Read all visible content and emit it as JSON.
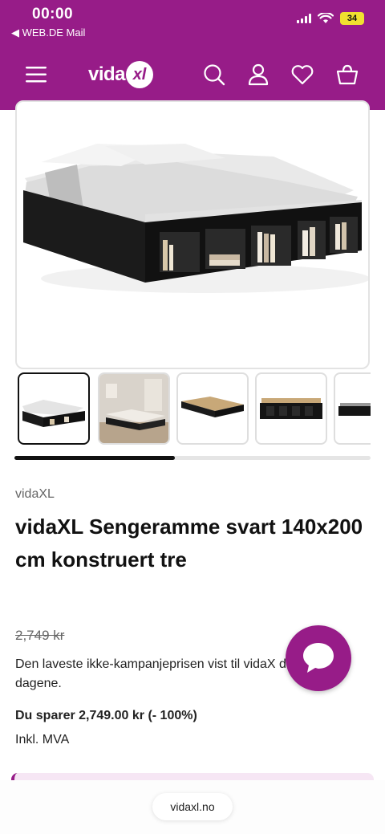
{
  "status_bar": {
    "time": "00:00",
    "back_app": "◀ WEB.DE Mail",
    "battery": "34"
  },
  "header": {
    "logo_text": "vida",
    "logo_badge": "xl",
    "brand_color": "#971c88",
    "icons": [
      "menu-icon",
      "search-icon",
      "user-icon",
      "heart-icon",
      "basket-icon"
    ]
  },
  "gallery": {
    "thumbnail_count": 5,
    "active_index": 0,
    "scroll_progress": 0.45
  },
  "product": {
    "brand": "vidaXL",
    "title": "vidaXL Sengeramme svart 140x200 cm konstruert tre",
    "old_price": "2,749 kr",
    "lowest_price_note": "Den laveste ikke-kampanjeprisen vist til vidaX de siste 30 dagene.",
    "savings": "Du sparer 2,749.00 kr (- 100%)",
    "vat": "Inkl. MVA"
  },
  "browser": {
    "url": "vidaxl.no"
  }
}
